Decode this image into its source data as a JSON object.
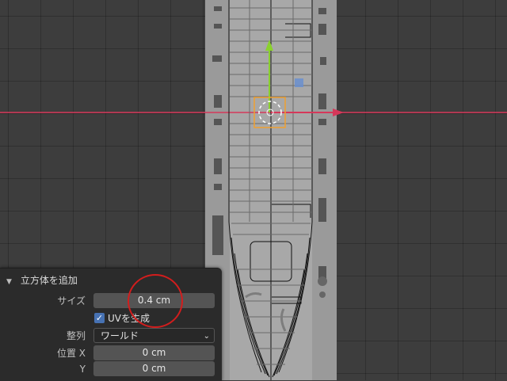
{
  "panel": {
    "title": "立方体を追加",
    "size_label": "サイズ",
    "size_value": "0.4 cm",
    "uv_label": "UVを生成",
    "uv_checked": true,
    "align_label": "整列",
    "align_value": "ワールド",
    "pos_x_label": "位置 X",
    "pos_x_value": "0 cm",
    "pos_y_label": "Y",
    "pos_y_value": "0 cm"
  },
  "icons": {
    "collapse": "triangle-down-icon",
    "check": "checkmark-icon",
    "dropdown": "chevron-down-icon"
  },
  "colors": {
    "x_axis": "#d6385a",
    "y_axis": "#8ad12d",
    "selection": "#f0a030",
    "annotation": "#d21d1d",
    "accent": "#4772b3"
  }
}
